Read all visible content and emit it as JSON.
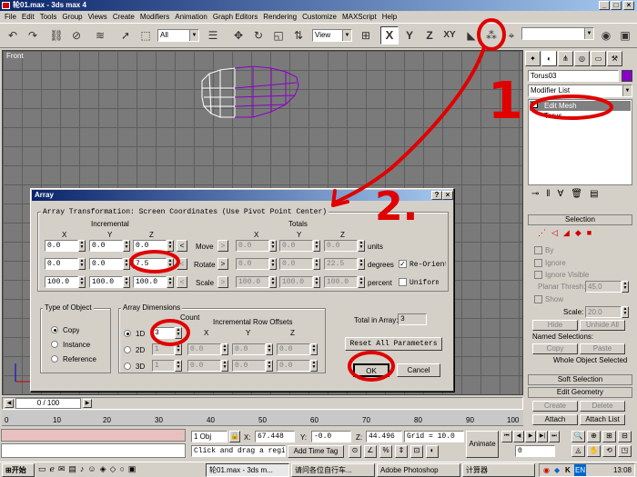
{
  "window": {
    "title": "轮01.max - 3ds max 4"
  },
  "menu": [
    "File",
    "Edit",
    "Tools",
    "Group",
    "Views",
    "Create",
    "Modifiers",
    "Animation",
    "Graph Editors",
    "Rendering",
    "Customize",
    "MAXScript",
    "Help"
  ],
  "toolbar": {
    "selection_filter": "All",
    "reference_coord": "View",
    "axis_x": "X",
    "axis_y": "Y",
    "axis_z": "Z",
    "axis_xy": "XY"
  },
  "viewport": {
    "label": "Front"
  },
  "command_panel": {
    "object_name": "Torus03",
    "modifier_list": "Modifier List",
    "stack": [
      "Edit Mesh",
      "Torus"
    ],
    "selection": {
      "title": "Selection",
      "by": "By",
      "ignore": "Ignore",
      "ignore_visible": "Ignore Visible",
      "planar_label": "Planar Thresh:",
      "planar_value": "45.0",
      "show": "Show",
      "scale_label": "Scale:",
      "scale_value": "20.0",
      "hide": "Hide",
      "unhide_all": "Unhide All",
      "named": "Named Selections:",
      "copy": "Copy",
      "paste": "Paste",
      "whole": "Whole Object Selected"
    },
    "soft_selection": "Soft Selection",
    "edit_geometry": "Edit Geometry",
    "create": "Create",
    "delete": "Delete",
    "attach": "Attach",
    "attach_list": "Attach List"
  },
  "dialog": {
    "title": "Array",
    "help": "?",
    "close": "×",
    "transform_header": "Array Transformation: Screen Coordinates (Use Pivot Point Center)",
    "incremental": "Incremental",
    "totals": "Totals",
    "x": "X",
    "y": "Y",
    "z": "Z",
    "move": {
      "label": "Move",
      "inc": [
        "0.0",
        "0.0",
        "0.0"
      ],
      "tot": [
        "0.0",
        "0.0",
        "0.0"
      ],
      "unit": "units"
    },
    "rotate": {
      "label": "Rotate",
      "inc": [
        "0.0",
        "0.0",
        "7.5"
      ],
      "tot": [
        "0.0",
        "0.0",
        "22.5"
      ],
      "unit": "degrees"
    },
    "scale": {
      "label": "Scale",
      "inc": [
        "100.0",
        "100.0",
        "100.0"
      ],
      "tot": [
        "100.0",
        "100.0",
        "100.0"
      ],
      "unit": "percent"
    },
    "re_orient": "Re-Orient",
    "uniform": "Uniform",
    "type_of_object": "Type of Object",
    "copy": "Copy",
    "instance": "Instance",
    "reference": "Reference",
    "array_dimensions": "Array Dimensions",
    "count": "Count",
    "inc_row_offsets": "Incremental Row Offsets",
    "d1": "1D",
    "d1_count": "3",
    "d2": "2D",
    "d2_count": "1",
    "d2_offsets": [
      "0.0",
      "0.0",
      "0.0"
    ],
    "d3": "3D",
    "d3_count": "1",
    "d3_offsets": [
      "0.0",
      "0.0",
      "0.0"
    ],
    "total_label": "Total in Array:",
    "total_value": "3",
    "reset": "Reset All Parameters",
    "ok": "OK",
    "cancel": "Cancel"
  },
  "timeline": {
    "frame": "0 / 100",
    "ticks": [
      "0",
      "10",
      "20",
      "30",
      "40",
      "50",
      "60",
      "70",
      "80",
      "90",
      "100"
    ]
  },
  "status": {
    "objects": "1 Obj",
    "x_label": "X:",
    "x_val": "67.448",
    "y_label": "Y:",
    "y_val": "-0.0",
    "z_label": "Z:",
    "z_val": "44.496",
    "grid": "Grid = 10.0",
    "prompt": "Click and drag a region",
    "add_time_tag": "Add Time Tag",
    "animate": "Animate",
    "frame_field": "0"
  },
  "taskbar": {
    "start": "开始",
    "tasks": [
      "轮01.max - 3ds m...",
      "请问各位自行车...",
      "Adobe Photoshop",
      "计算器"
    ],
    "clock": "13:08"
  },
  "annotations": [
    "1",
    "2."
  ],
  "colors": {
    "title_blue": "#0a246a",
    "viewport_gray": "#7a7a7a",
    "annotation_red": "#e00000",
    "object_purple": "#8a00c8"
  }
}
